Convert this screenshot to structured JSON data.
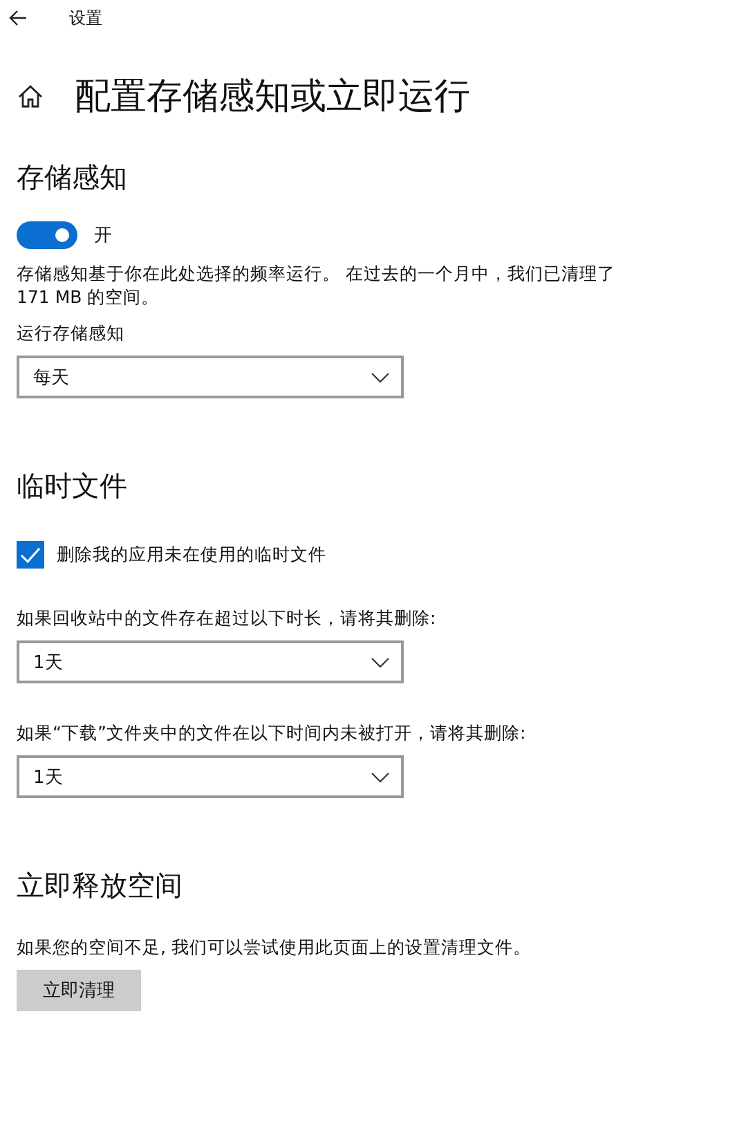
{
  "window": {
    "title": "设置"
  },
  "page_title": "配置存储感知或立即运行",
  "storage_sense": {
    "heading": "存储感知",
    "toggle": {
      "on": true,
      "label": "开"
    },
    "description": "存储感知基于你在此处选择的频率运行。 在过去的一个月中，我们已清理了 171 MB 的空间。",
    "run_label": "运行存储感知",
    "run_value": "每天"
  },
  "temp_files": {
    "heading": "临时文件",
    "checkbox": {
      "label": "删除我的应用未在使用的临时文件",
      "checked": true
    },
    "dropdowns": [
      {
        "label": "如果回收站中的文件存在超过以下时长，请将其删除:",
        "value": "1天"
      },
      {
        "label": "如果“下载”文件夹中的文件在以下时间内未被打开，请将其删除:",
        "value": "1天"
      }
    ]
  },
  "free_now": {
    "heading": "立即释放空间",
    "description": "如果您的空间不足, 我们可以尝试使用此页面上的设置清理文件。",
    "button": "立即清理"
  }
}
